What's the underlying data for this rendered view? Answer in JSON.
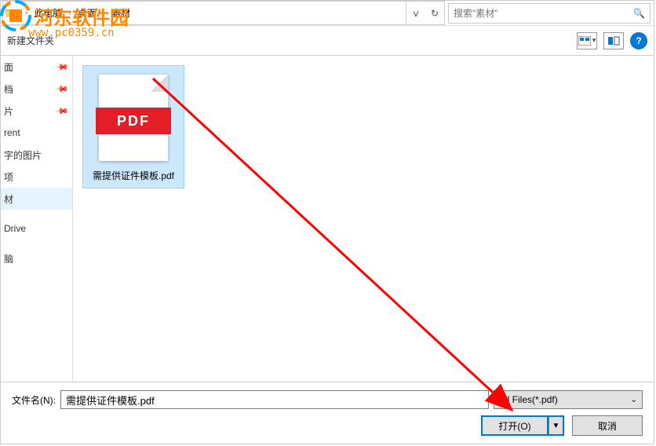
{
  "watermark": {
    "site_name": "河东软件园",
    "url": "www.pc0359.cn"
  },
  "breadcrumb": {
    "items": [
      "此电脑",
      "桌面",
      "素材"
    ]
  },
  "search": {
    "placeholder": "搜索\"素材\""
  },
  "toolbar": {
    "new_folder": "新建文件夹"
  },
  "sidebar": {
    "items": [
      {
        "label": "面",
        "pinned": true
      },
      {
        "label": "档",
        "pinned": true
      },
      {
        "label": "片",
        "pinned": true
      },
      {
        "label": "rent",
        "pinned": false
      },
      {
        "label": "字的图片",
        "pinned": false
      },
      {
        "label": "项",
        "pinned": false
      },
      {
        "label": "材",
        "pinned": false,
        "selected": true
      },
      {
        "label": "Drive",
        "pinned": false
      },
      {
        "label": "脑",
        "pinned": false
      }
    ]
  },
  "files": [
    {
      "name": "需提供证件模板.pdf",
      "type": "pdf",
      "badge": "PDF"
    }
  ],
  "bottom": {
    "filename_label": "文件名(N):",
    "filename_value": "需提供证件模板.pdf",
    "filetype": "All Files(*.pdf)",
    "open_label": "打开(O)",
    "cancel_label": "取消"
  }
}
